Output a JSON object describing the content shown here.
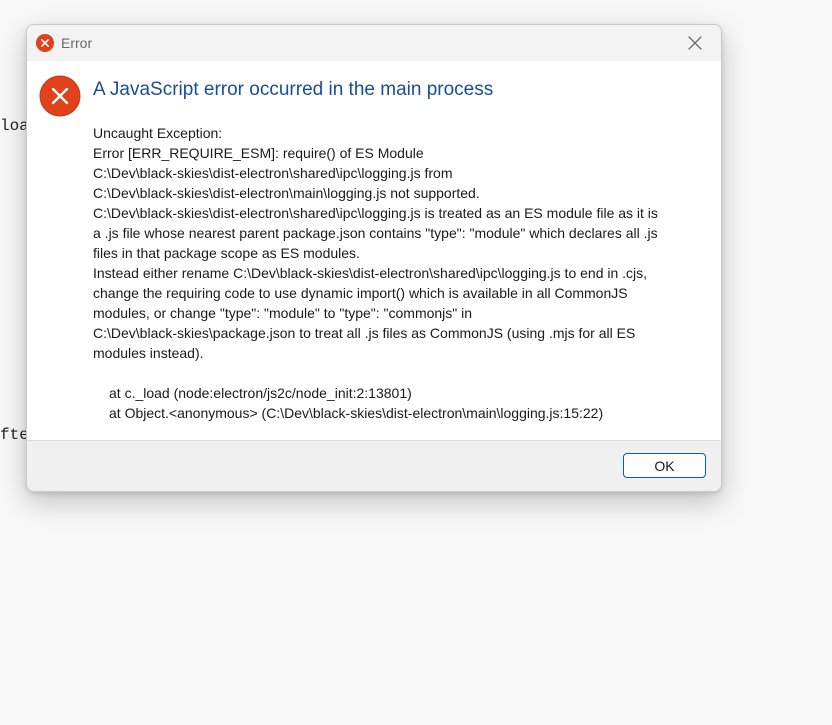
{
  "background": {
    "code_fragment_1": "loa",
    "code_fragment_2": "fte"
  },
  "dialog": {
    "title": "Error",
    "heading": "A JavaScript error occurred in the main process",
    "message_lines": [
      "Uncaught Exception:",
      "Error [ERR_REQUIRE_ESM]: require() of ES Module",
      "C:\\Dev\\black-skies\\dist-electron\\shared\\ipc\\logging.js from",
      "C:\\Dev\\black-skies\\dist-electron\\main\\logging.js not supported.",
      "C:\\Dev\\black-skies\\dist-electron\\shared\\ipc\\logging.js is treated as an ES module file as it is",
      "a .js file whose nearest parent package.json contains \"type\": \"module\" which declares all .js",
      "files in that package scope as ES modules.",
      "Instead either rename C:\\Dev\\black-skies\\dist-electron\\shared\\ipc\\logging.js to end in .cjs,",
      "change the requiring code to use dynamic import() which is available in all CommonJS",
      "modules, or change \"type\": \"module\" to \"type\": \"commonjs\" in",
      "C:\\Dev\\black-skies\\package.json to treat all .js files as CommonJS (using .mjs for all ES",
      "modules instead)."
    ],
    "stack_lines": [
      "at c._load (node:electron/js2c/node_init:2:13801)",
      "at Object.<anonymous> (C:\\Dev\\black-skies\\dist-electron\\main\\logging.js:15:22)"
    ],
    "ok_label": "OK",
    "icons": {
      "title_icon": "error-icon",
      "big_icon": "error-icon",
      "close": "close-icon"
    },
    "colors": {
      "error_red": "#e0421c",
      "heading_blue": "#1b4d96",
      "button_border": "#0b5cad"
    }
  }
}
